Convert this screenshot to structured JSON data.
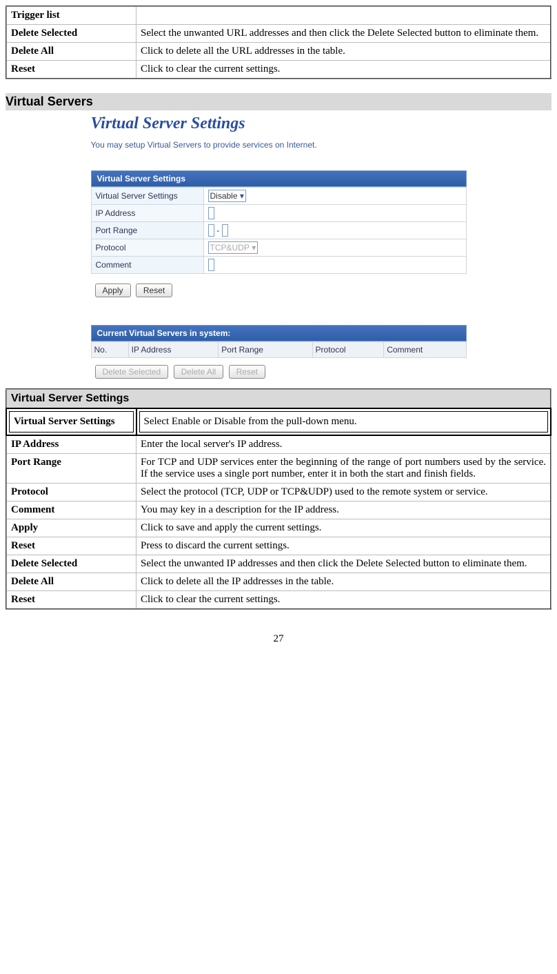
{
  "top_table": {
    "rows": [
      {
        "label": "Trigger list",
        "desc": ""
      },
      {
        "label": "Delete Selected",
        "desc": "Select the unwanted URL addresses and then click the Delete Selected button to eliminate them."
      },
      {
        "label": "Delete All",
        "desc": "Click to delete all the URL addresses in the table."
      },
      {
        "label": "Reset",
        "desc": "Click to clear the current settings."
      }
    ]
  },
  "section_title": "Virtual Servers",
  "screenshot": {
    "title": "Virtual Server Settings",
    "caption": "You may setup Virtual Servers to provide services on Internet.",
    "panel_header": "Virtual Server Settings",
    "rows": {
      "r1": "Virtual Server Settings",
      "r2": "IP Address",
      "r3": "Port Range",
      "r4": "Protocol",
      "r5": "Comment"
    },
    "dropdown_val": "Disable",
    "protocol_val": "TCP&UDP",
    "range_sep": "-",
    "btn_apply": "Apply",
    "btn_reset": "Reset",
    "current_header": "Current Virtual Servers in system:",
    "cols": {
      "c1": "No.",
      "c2": "IP Address",
      "c3": "Port Range",
      "c4": "Protocol",
      "c5": "Comment"
    },
    "btn_del_sel": "Delete Selected",
    "btn_del_all": "Delete All",
    "btn_reset2": "Reset"
  },
  "vs_table": {
    "header": "Virtual Server Settings",
    "rows": [
      {
        "label": "Virtual Server Settings",
        "desc": "Select Enable or Disable from the pull-down menu."
      },
      {
        "label": "IP Address",
        "desc": "Enter the local server's IP address."
      },
      {
        "label": "Port Range",
        "desc": "For TCP and UDP services enter the beginning of the range of port numbers used by the service. If the service uses a single port number, enter it in both the start and finish fields."
      },
      {
        "label": "Protocol",
        "desc": "Select the protocol (TCP, UDP or TCP&UDP) used to the remote system or service."
      },
      {
        "label": "Comment",
        "desc": "You may key in a description for the IP address."
      },
      {
        "label": "Apply",
        "desc": "Click to save and apply the current settings."
      },
      {
        "label": "Reset",
        "desc": "Press to discard the current settings."
      },
      {
        "label": "Delete Selected",
        "desc": "Select the unwanted IP addresses and then click the Delete Selected button to eliminate them."
      },
      {
        "label": "Delete All",
        "desc": "Click to delete all the IP addresses in the table."
      },
      {
        "label": "Reset",
        "desc": "Click to clear the current settings."
      }
    ]
  },
  "page_number": "27"
}
